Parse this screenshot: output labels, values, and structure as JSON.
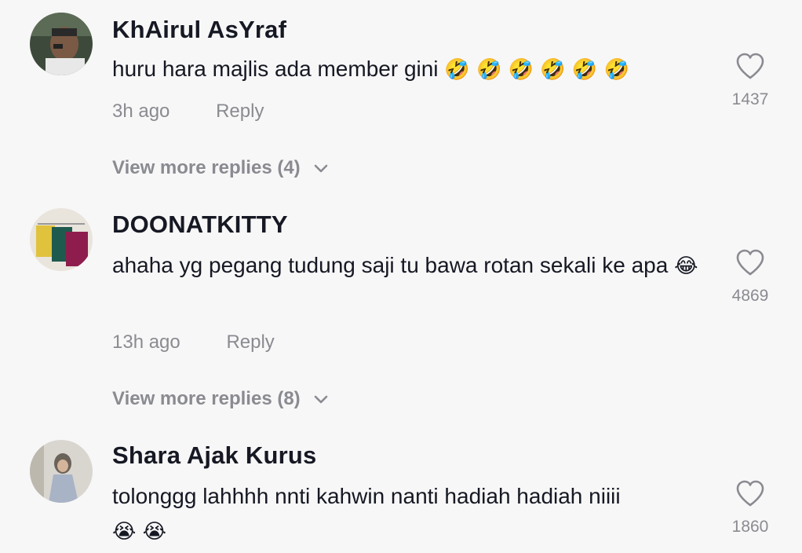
{
  "comments": [
    {
      "username": "KhAirul AsYraf",
      "text": "huru hara majlis ada member gini",
      "emojis": "🤣 🤣 🤣 🤣 🤣 🤣",
      "time": "3h ago",
      "reply_label": "Reply",
      "likes": "1437",
      "view_more": "View more replies (4)"
    },
    {
      "username": "DOONATKITTY",
      "text": "ahaha yg pegang tudung saji tu bawa rotan sekali ke apa",
      "emojis": "😂",
      "time": "13h ago",
      "reply_label": "Reply",
      "likes": "4869",
      "view_more": "View more replies (8)"
    },
    {
      "username": "Shara Ajak Kurus",
      "text": "tolonggg lahhhh nnti kahwin nanti hadiah hadiah niiii",
      "emojis": "😭 😭",
      "likes": "1860"
    }
  ],
  "icons": {
    "like": "heart-outline-icon",
    "expand": "chevron-down-icon"
  },
  "colors": {
    "background": "#f7f7f7",
    "primary_text": "#161823",
    "secondary_text": "#8a8b91"
  }
}
